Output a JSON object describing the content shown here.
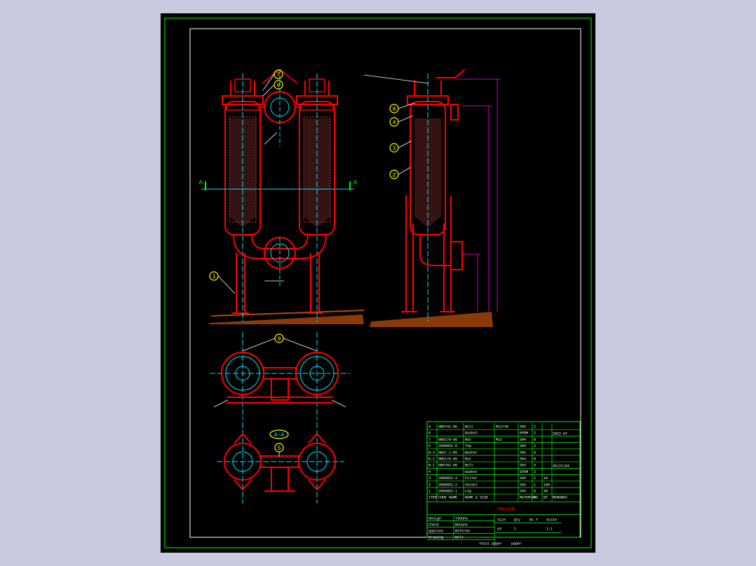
{
  "colors": {
    "background": "#c9c9e0",
    "sheet": "#000000",
    "outline": "#ff0000",
    "center": "#00e5ff",
    "frame": "#00ff00",
    "leader": "#ffffff",
    "callout_fill": "#ffff00",
    "dimension": "#ff00ff",
    "ground": "#b34a0a"
  },
  "callouts": {
    "c7": "7",
    "c6": "6",
    "c8": "8",
    "c4": "4",
    "c3": "3",
    "c2": "2",
    "c1": "1",
    "c9": "9",
    "c5": "5"
  },
  "section": {
    "left_mark": "A",
    "right_mark": "A",
    "view_label": "A-A"
  },
  "title_block": {
    "rows": [
      {
        "no": "9",
        "code": "GB8742-86",
        "name": "Bolt",
        "spec": "M12×30",
        "mat": "304",
        "qty": "2",
        "extra": ""
      },
      {
        "no": "8",
        "code": "",
        "name": "Gasket",
        "spec": "",
        "mat": "EPDM",
        "qty": "2",
        "extra": ""
      },
      {
        "no": "7",
        "code": "GB6170-86",
        "name": "Nut",
        "spec": "M12",
        "mat": "304",
        "qty": "8",
        "extra": ""
      },
      {
        "no": "6",
        "code": "2089052-6",
        "name": "Top",
        "spec": "",
        "mat": "304",
        "qty": "2",
        "extra": ""
      },
      {
        "no": "B-3",
        "code": "GB97.1-85",
        "name": "Washer",
        "spec": "",
        "mat": "304",
        "qty": "8",
        "extra": ""
      },
      {
        "no": "B-2",
        "code": "GB6170-86",
        "name": "Nut",
        "spec": "",
        "mat": "304",
        "qty": "8",
        "extra": ""
      },
      {
        "no": "B-1",
        "code": "GB5782-86",
        "name": "Bolt",
        "spec": "",
        "mat": "304",
        "qty": "4",
        "extra": ""
      },
      {
        "no": "4",
        "code": "",
        "name": "Gasket",
        "spec": "",
        "mat": "EPDM",
        "qty": "2",
        "extra": ""
      },
      {
        "no": "3",
        "code": "2089052-3",
        "name": "Filter",
        "spec": "",
        "mat": "304",
        "qty": "2",
        "extra": "10"
      },
      {
        "no": "2",
        "code": "2089052-2",
        "name": "Vessel",
        "spec": "",
        "mat": "304",
        "qty": "1",
        "extra": "180"
      },
      {
        "no": "1",
        "code": "2089052-1",
        "name": "Leg",
        "spec": "",
        "mat": "304",
        "qty": "6",
        "extra": "30"
      }
    ],
    "header": {
      "no": "ITEM",
      "code": "CODE NAME",
      "name": "NAME & SIZE",
      "mat": "MATERIAL",
      "qty": "NO",
      "wt": "WT",
      "remarks": "REMARKS"
    },
    "drawing_title": "双联过滤器",
    "sign_rows": [
      {
        "label": "Design",
        "value": "Yaduha"
      },
      {
        "label": "Check",
        "value": "Beaune"
      },
      {
        "label": "Approve",
        "value": "Referee"
      },
      {
        "label": "Drawing",
        "value": "Bolt"
      }
    ],
    "size_header": [
      "Size",
      "Qty",
      "Wt.T",
      "Scale"
    ],
    "size_values": [
      "A3",
      "1",
      "",
      "1:1"
    ],
    "footer_left": "Total paper",
    "footer_right": "paper",
    "right_notes": [
      "2022.07",
      "45|21|84"
    ]
  }
}
